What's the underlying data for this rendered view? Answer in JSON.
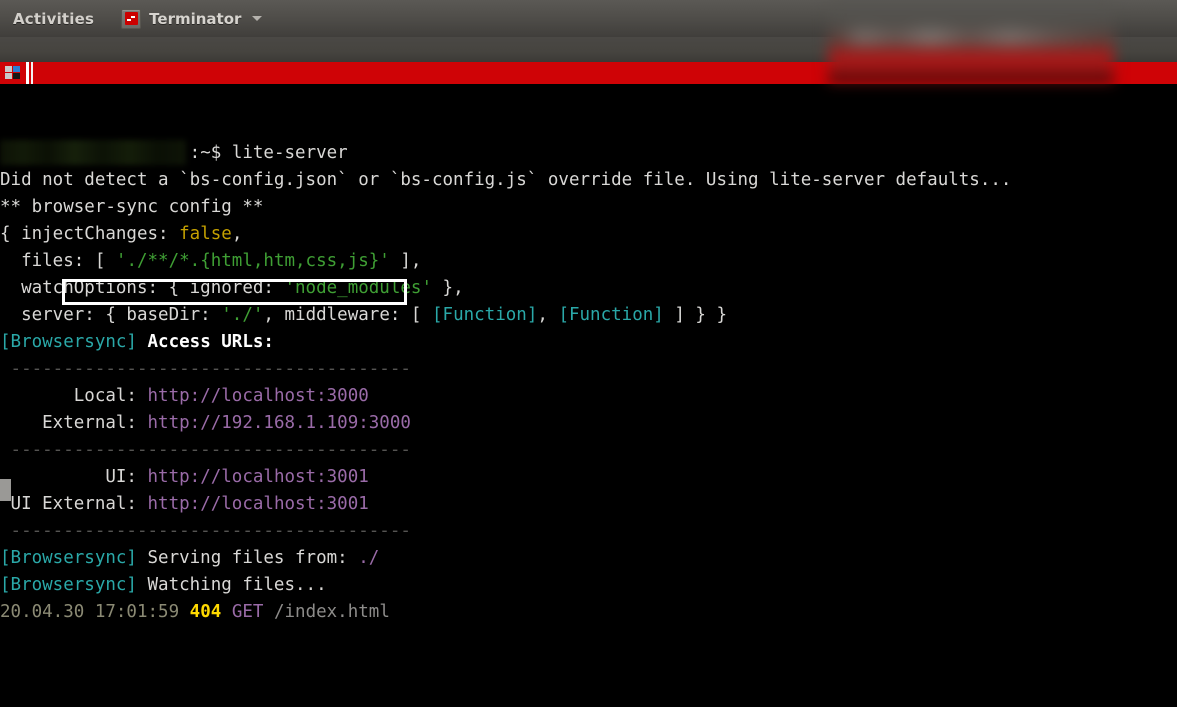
{
  "desktop": {
    "activities_label": "Activities",
    "app_name": "Terminator",
    "app_icon": "terminal-icon",
    "menu_caret": "chevron-down-icon"
  },
  "window": {
    "titlebar_icon": "terminator-layout-icon",
    "titlebar_color": "#cf0306",
    "redacted_region": true
  },
  "terminal": {
    "background": "#000000",
    "foreground": "#d0cfcc",
    "prompt": {
      "user_host_redacted": true,
      "prompt_suffix": ":~$ ",
      "command": "lite-server"
    },
    "lines": [
      {
        "id": "line-prompt",
        "segments": [
          {
            "text": "                  ",
            "color": "redacted"
          },
          {
            "text": ":~$ ",
            "color": "white"
          },
          {
            "text": "lite-server",
            "color": "white"
          }
        ]
      },
      {
        "id": "line-no-config",
        "segments": [
          {
            "text": "Did not detect a `bs-config.json` or `bs-config.js` override file. Using lite-server defaults...",
            "color": "white"
          }
        ]
      },
      {
        "id": "line-config-header",
        "segments": [
          {
            "text": "** browser-sync config **",
            "color": "white"
          }
        ]
      },
      {
        "id": "line-injectchanges",
        "segments": [
          {
            "text": "{ injectChanges: ",
            "color": "white"
          },
          {
            "text": "false",
            "color": "yellow"
          },
          {
            "text": ",",
            "color": "white"
          }
        ]
      },
      {
        "id": "line-files",
        "segments": [
          {
            "text": "  files: [ ",
            "color": "white"
          },
          {
            "text": "'./**/*.{html,htm,css,js}'",
            "color": "green"
          },
          {
            "text": " ],",
            "color": "white"
          }
        ]
      },
      {
        "id": "line-watchoptions",
        "segments": [
          {
            "text": "  watchOptions: { ignored: ",
            "color": "white"
          },
          {
            "text": "'node_modules'",
            "color": "green"
          },
          {
            "text": " },",
            "color": "white"
          }
        ]
      },
      {
        "id": "line-server",
        "segments": [
          {
            "text": "  server: { baseDir: ",
            "color": "white"
          },
          {
            "text": "'./'",
            "color": "green"
          },
          {
            "text": ", middleware: [ ",
            "color": "white"
          },
          {
            "text": "[Function]",
            "color": "cyan"
          },
          {
            "text": ", ",
            "color": "white"
          },
          {
            "text": "[Function]",
            "color": "cyan"
          },
          {
            "text": " ] } }",
            "color": "white"
          }
        ]
      },
      {
        "id": "line-access-urls",
        "segments": [
          {
            "text": "[Browsersync]",
            "color": "cyan"
          },
          {
            "text": " ",
            "color": "white"
          },
          {
            "text": "Access URLs:",
            "color": "bold"
          }
        ]
      },
      {
        "id": "line-sep-1",
        "segments": [
          {
            "text": " --------------------------------------",
            "color": "dash"
          }
        ]
      },
      {
        "id": "line-local",
        "segments": [
          {
            "text": "       Local: ",
            "color": "white"
          },
          {
            "text": "http://localhost:3000",
            "color": "magenta"
          }
        ]
      },
      {
        "id": "line-external",
        "segments": [
          {
            "text": "    External: ",
            "color": "white"
          },
          {
            "text": "http://192.168.1.109:3000",
            "color": "magenta"
          }
        ]
      },
      {
        "id": "line-sep-2",
        "segments": [
          {
            "text": " --------------------------------------",
            "color": "dash"
          }
        ]
      },
      {
        "id": "line-ui",
        "segments": [
          {
            "text": "          UI: ",
            "color": "white"
          },
          {
            "text": "http://localhost:3001",
            "color": "magenta"
          }
        ]
      },
      {
        "id": "line-ui-external",
        "segments": [
          {
            "text": " UI External: ",
            "color": "white"
          },
          {
            "text": "http://localhost:3001",
            "color": "magenta"
          }
        ]
      },
      {
        "id": "line-sep-3",
        "segments": [
          {
            "text": " --------------------------------------",
            "color": "dash"
          }
        ]
      },
      {
        "id": "line-serving",
        "segments": [
          {
            "text": "[Browsersync]",
            "color": "cyan"
          },
          {
            "text": " Serving files from: ",
            "color": "white"
          },
          {
            "text": "./",
            "color": "magenta"
          }
        ]
      },
      {
        "id": "line-watching",
        "segments": [
          {
            "text": "[Browsersync]",
            "color": "cyan"
          },
          {
            "text": " Watching files...",
            "color": "white"
          }
        ]
      },
      {
        "id": "line-request-log",
        "segments": [
          {
            "text": "20.04.30 17:01:59 ",
            "color": "dim"
          },
          {
            "text": "404",
            "color": "yellowb"
          },
          {
            "text": " ",
            "color": "white"
          },
          {
            "text": "GET",
            "color": "magenta"
          },
          {
            "text": " /index.html",
            "color": "gray"
          }
        ]
      }
    ],
    "highlight": {
      "target_line": "line-local",
      "note": "white rectangle annotation around Local URL",
      "color": "#ffffff"
    },
    "cursor": {
      "shape": "block",
      "color": "#9a9996"
    }
  }
}
